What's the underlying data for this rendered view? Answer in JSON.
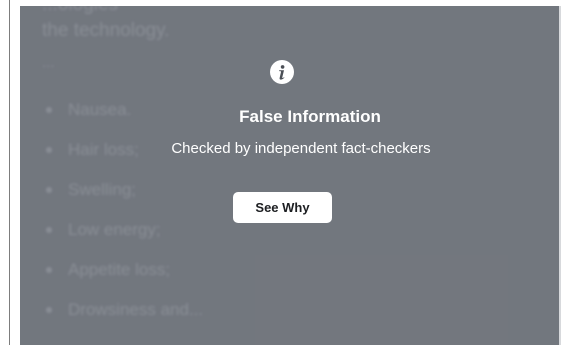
{
  "background_post": {
    "top_line": "...ologies",
    "heading": "the technology.",
    "ellipsis": "...",
    "list_items": [
      "Nausea.",
      "Hair loss;",
      "Swelling;",
      "Low energy;",
      "Appetite loss;",
      "Drowsiness and..."
    ]
  },
  "warning": {
    "icon": "info-icon",
    "title": "False Information",
    "subtitle": "Checked by independent fact-checkers",
    "button_label": "See Why"
  },
  "colors": {
    "overlay": "#8b8f96",
    "text_on_overlay": "#ffffff",
    "button_bg": "#ffffff",
    "button_text": "#1c1e21"
  }
}
